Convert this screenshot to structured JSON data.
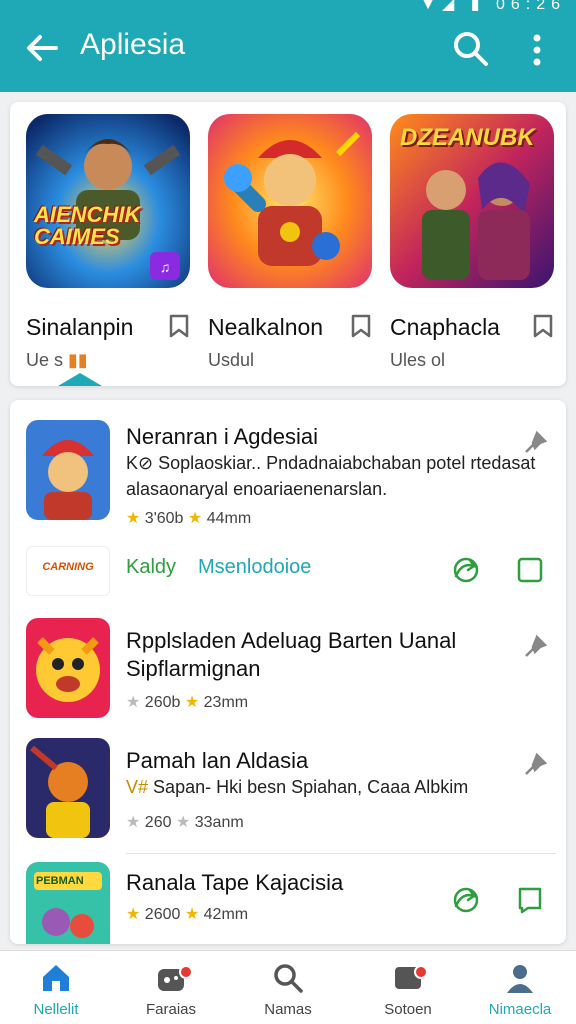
{
  "appbar": {
    "title": "Apliesia",
    "status_text": "▼◢ ▮ 06:26",
    "colors": {
      "primary": "#1fa8b6"
    },
    "icons": [
      "back-arrow-icon",
      "search-icon",
      "more-vert-icon"
    ]
  },
  "featured": [
    {
      "name": "Sinalanpin",
      "sub": "Ue s",
      "art_text": "AIENCHIK CAIMES",
      "icon": "bookmark-icon"
    },
    {
      "name": "Nealkalnon",
      "sub": "Usdul",
      "art_text": "",
      "icon": "bookmark-icon"
    },
    {
      "name": "Cnaphacla",
      "sub": "Ules ol",
      "art_text": "DZEANUBK",
      "icon": "bookmark-icon"
    }
  ],
  "list": [
    {
      "title": "Neranran i Agdesiai",
      "desc": "K⊘ Soplaoskiar.. Pndadnaiabchaban potel rtedasat alasaonaryal enoariaenenarslan.",
      "rating": "3'60b",
      "rating2": "44mm"
    },
    {
      "actions_row": {
        "logo_text": "CARNING",
        "label_a": "Kaldy",
        "label_b": "Msenlodoioe"
      }
    },
    {
      "title": "Rpplsladen Adeluag Barten Uanal",
      "title2": "Sipflarmignan",
      "rating": "260b",
      "rating2": "23mm"
    },
    {
      "title": "Pamah lan Aldasia",
      "desc_prefix": "V#",
      "desc": "Sapan- Hki besn Spiahan, Caaa Albkim",
      "rating": "260",
      "rating2": "33anm"
    },
    {
      "title": "Ranala Tape Kajacisia",
      "logo_text": "PEBMAN",
      "rating": "2600",
      "rating2": "42mm"
    }
  ],
  "bottomnav": [
    {
      "label": "Nellelit",
      "active": true,
      "icon": "home-icon"
    },
    {
      "label": "Faraias",
      "active": false,
      "icon": "games-icon"
    },
    {
      "label": "Namas",
      "active": false,
      "icon": "search-icon"
    },
    {
      "label": "Sotoen",
      "active": false,
      "icon": "notifications-icon"
    },
    {
      "label": "Nimaecla",
      "active": false,
      "icon": "profile-icon"
    }
  ]
}
